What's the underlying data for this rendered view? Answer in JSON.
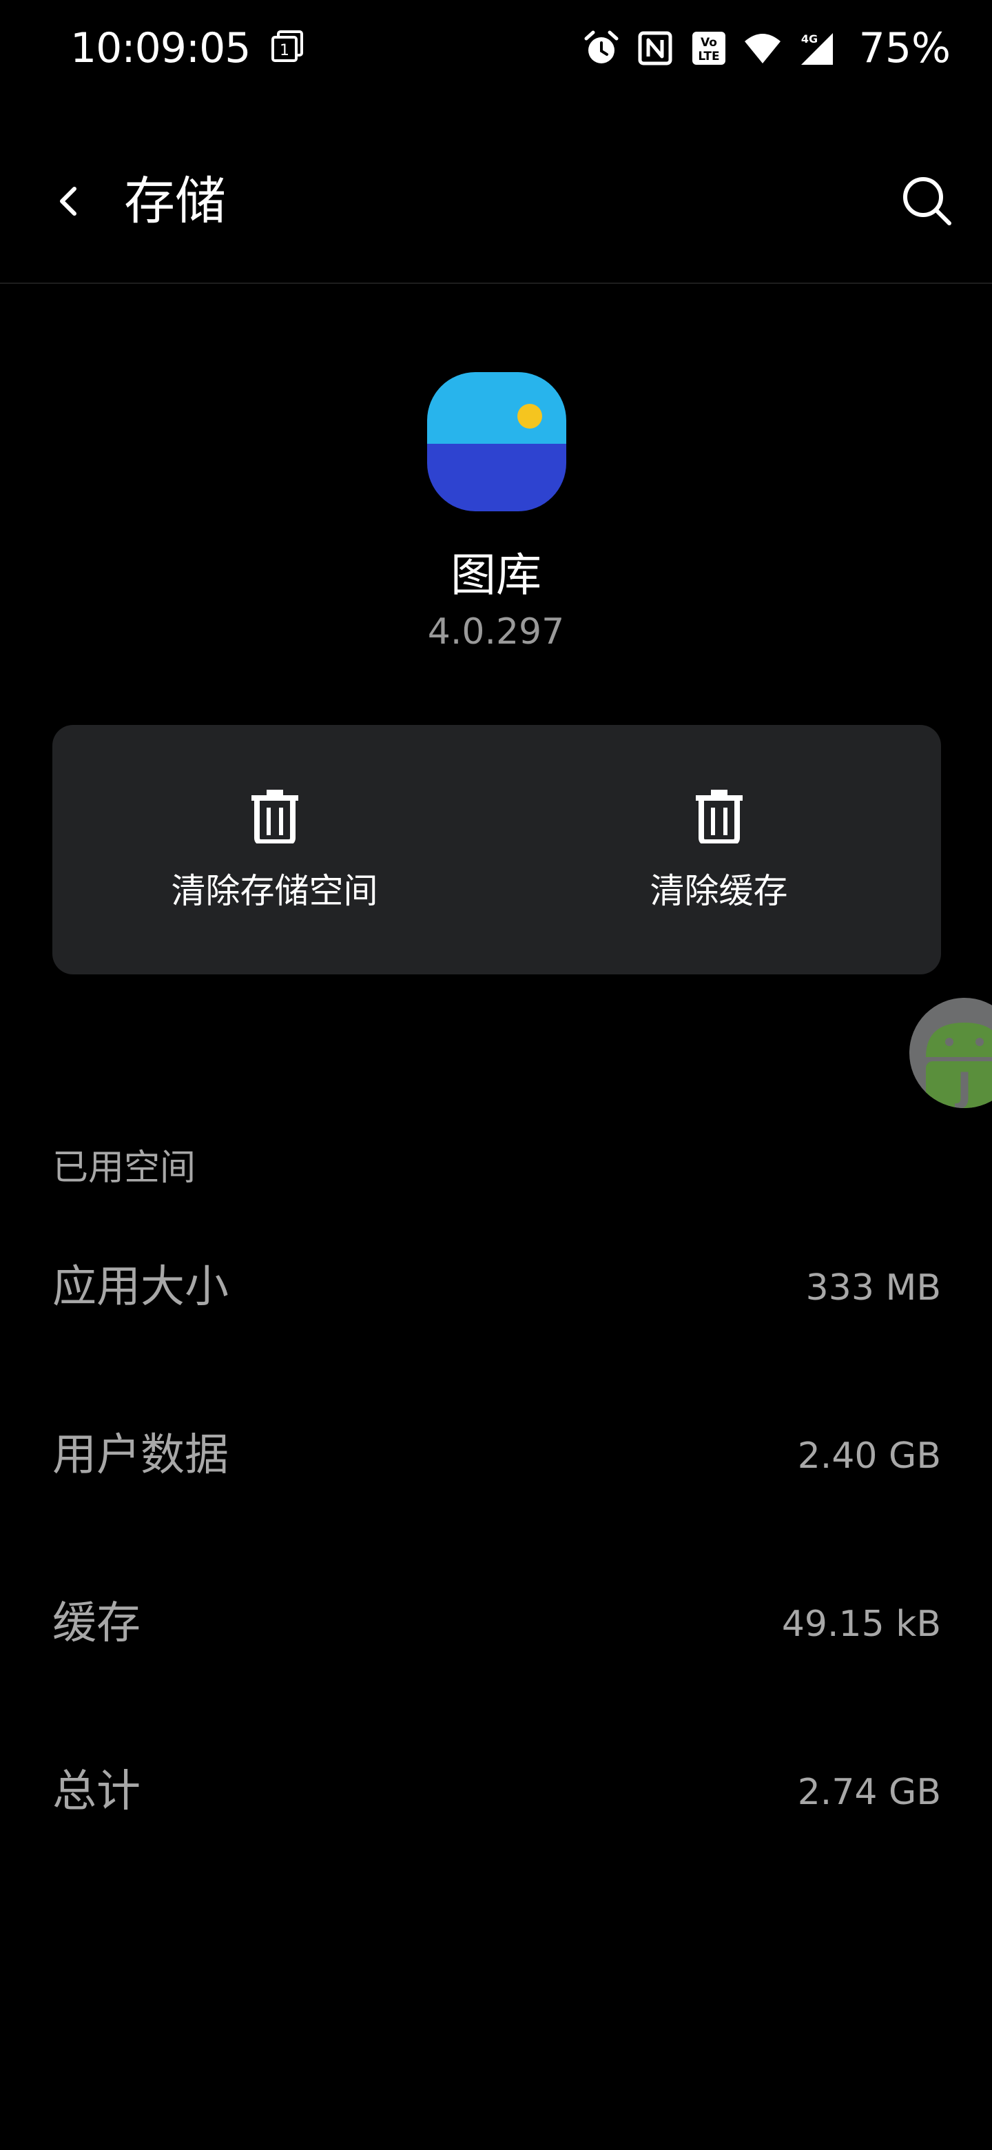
{
  "status_bar": {
    "time": "10:09:05",
    "battery": "75%",
    "icons": [
      "notification-stack-icon",
      "alarm-icon",
      "nfc-icon",
      "volte-icon",
      "wifi-icon",
      "signal-4g-icon"
    ]
  },
  "header": {
    "title": "存储",
    "back_icon": "back-arrow-icon",
    "search_icon": "search-icon"
  },
  "app": {
    "name": "图库",
    "version": "4.0.297",
    "icon": "gallery-app-icon"
  },
  "actions": {
    "clear_storage_label": "清除存储空间",
    "clear_cache_label": "清除缓存",
    "icon": "trash-icon"
  },
  "storage": {
    "section_title": "已用空间",
    "rows": [
      {
        "label": "应用大小",
        "value": "333 MB"
      },
      {
        "label": "用户数据",
        "value": "2.40 GB"
      },
      {
        "label": "缓存",
        "value": "49.15 kB"
      },
      {
        "label": "总计",
        "value": "2.74 GB"
      }
    ]
  },
  "colors": {
    "background": "#000000",
    "card": "#222325",
    "secondary_text": "#a8a8a8",
    "app_icon_top": "#28b4ec",
    "app_icon_bottom": "#2e43d0",
    "app_icon_sun": "#f5c51f"
  }
}
